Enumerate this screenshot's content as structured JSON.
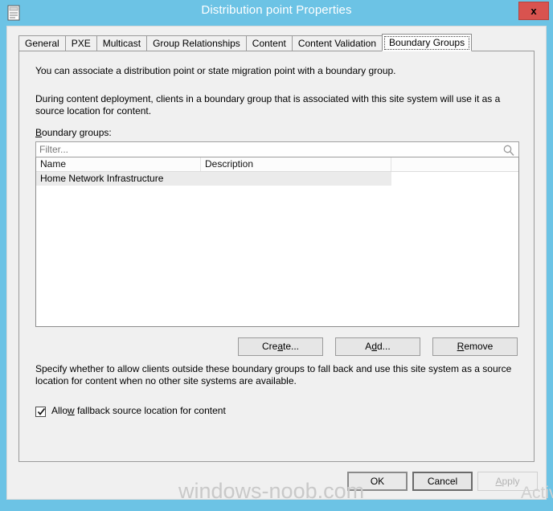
{
  "window": {
    "title": "Distribution point Properties",
    "icon": "properties-document-icon",
    "close_label": "x",
    "frame_color": "#6cc3e5"
  },
  "tabs": [
    {
      "label": "General",
      "active": false
    },
    {
      "label": "PXE",
      "active": false
    },
    {
      "label": "Multicast",
      "active": false
    },
    {
      "label": "Group Relationships",
      "active": false
    },
    {
      "label": "Content",
      "active": false
    },
    {
      "label": "Content Validation",
      "active": false
    },
    {
      "label": "Boundary Groups",
      "active": true
    }
  ],
  "page": {
    "intro_text": "You can associate a distribution point or state migration point with a boundary group.",
    "description_text": "During content deployment, clients in a boundary group that is associated with this site system will use it as a source location for content.",
    "boundary_groups_label": "Boundary groups:",
    "fallback_description": "Specify whether to allow clients outside these boundary groups to fall back and use this site system as a source location for content when no other site systems are available."
  },
  "filter": {
    "value": "",
    "placeholder": "Filter...",
    "icon": "search-icon"
  },
  "list": {
    "columns": [
      "Name",
      "Description",
      ""
    ],
    "rows": [
      {
        "name": "Home Network Infrastructure",
        "description": "",
        "selected": true
      }
    ]
  },
  "actions": {
    "create_label": "Create...",
    "add_label": "Add...",
    "remove_label": "Remove"
  },
  "checkbox": {
    "label_pre": "Allo",
    "label_accel": "w",
    "label_post": " fallback source location for content",
    "checked": true
  },
  "footer": {
    "ok_label": "OK",
    "cancel_label": "Cancel",
    "apply_label": "Apply",
    "apply_enabled": false
  },
  "watermarks": {
    "site": "windows-noob.com",
    "activation": "Activate Windows"
  }
}
